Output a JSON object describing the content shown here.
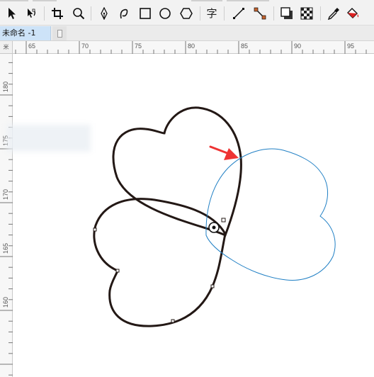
{
  "toolbar": {
    "tools": [
      {
        "name": "pick-tool",
        "icon": "arrow-pointer-icon"
      },
      {
        "name": "shape-tool",
        "icon": "shape-node-icon"
      },
      {
        "name": "crop-tool",
        "icon": "crop-icon"
      },
      {
        "name": "zoom-tool",
        "icon": "magnifier-icon"
      },
      {
        "name": "pen-tool",
        "icon": "pen-nib-icon"
      },
      {
        "name": "curve-tool",
        "icon": "curve-icon"
      },
      {
        "name": "rectangle-tool",
        "icon": "rectangle-icon"
      },
      {
        "name": "ellipse-tool",
        "icon": "ellipse-icon"
      },
      {
        "name": "polygon-tool",
        "icon": "polygon-icon"
      },
      {
        "name": "text-tool",
        "icon": "text-icon"
      },
      {
        "name": "line-tool",
        "icon": "line-icon"
      },
      {
        "name": "connector-tool",
        "icon": "connector-icon"
      },
      {
        "name": "drop-shadow-tool",
        "icon": "shadow-icon"
      },
      {
        "name": "transparency-tool",
        "icon": "checkerboard-icon"
      },
      {
        "name": "eyedropper-tool",
        "icon": "eyedropper-icon"
      },
      {
        "name": "fill-tool",
        "icon": "fill-bucket-icon"
      }
    ],
    "text_tool_glyph": "字"
  },
  "tabs": {
    "document_title": "未命名 -1"
  },
  "rulers": {
    "corner_unit": "米",
    "horizontal_labels": [
      "65",
      "70",
      "75",
      "80",
      "85",
      "90",
      "95"
    ],
    "vertical_labels": [
      "180",
      "175",
      "170",
      "165",
      "160"
    ]
  },
  "colors": {
    "shape_stroke": "#231815",
    "selected_outline": "#1f7fc4",
    "arrow": "#ee3333",
    "tab_active": "#cde3f8"
  }
}
